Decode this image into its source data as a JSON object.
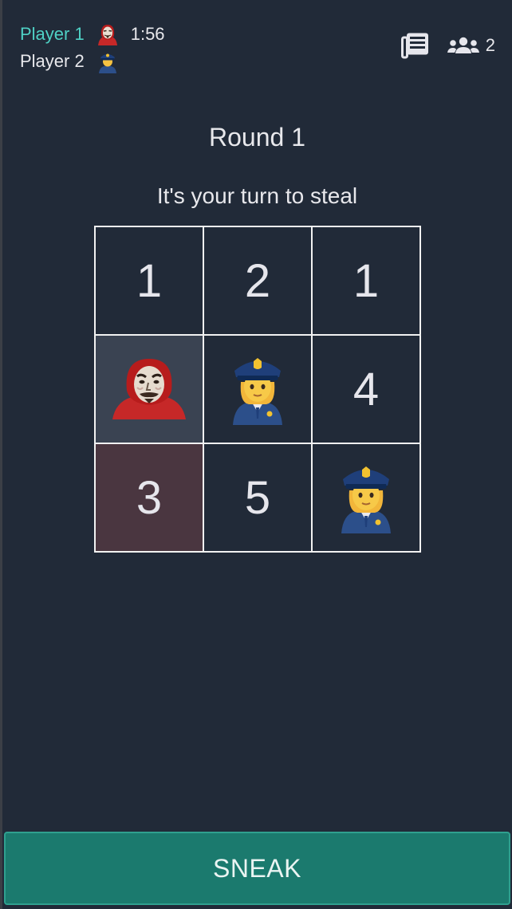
{
  "header": {
    "players": [
      {
        "name": "Player 1",
        "role": "robber",
        "active": true
      },
      {
        "name": "Player 2",
        "role": "police",
        "active": false
      }
    ],
    "timer": "1:56",
    "user_count": "2",
    "icons": {
      "history": "newspaper-icon",
      "users": "users-icon"
    }
  },
  "game": {
    "round_label": "Round 1",
    "status_text": "It's your turn to steal",
    "board": [
      {
        "content": "1",
        "type": "number"
      },
      {
        "content": "2",
        "type": "number"
      },
      {
        "content": "1",
        "type": "number"
      },
      {
        "content": "",
        "type": "robber"
      },
      {
        "content": "",
        "type": "police"
      },
      {
        "content": "4",
        "type": "number"
      },
      {
        "content": "3",
        "type": "number"
      },
      {
        "content": "5",
        "type": "number"
      },
      {
        "content": "",
        "type": "police"
      }
    ]
  },
  "actions": {
    "sneak_label": "SNEAK"
  },
  "colors": {
    "background": "#212a38",
    "active_player": "#4fd1c5",
    "button": "#1b7a6e",
    "robber_cell": "#3a4352",
    "target_cell": "#4a3640"
  }
}
